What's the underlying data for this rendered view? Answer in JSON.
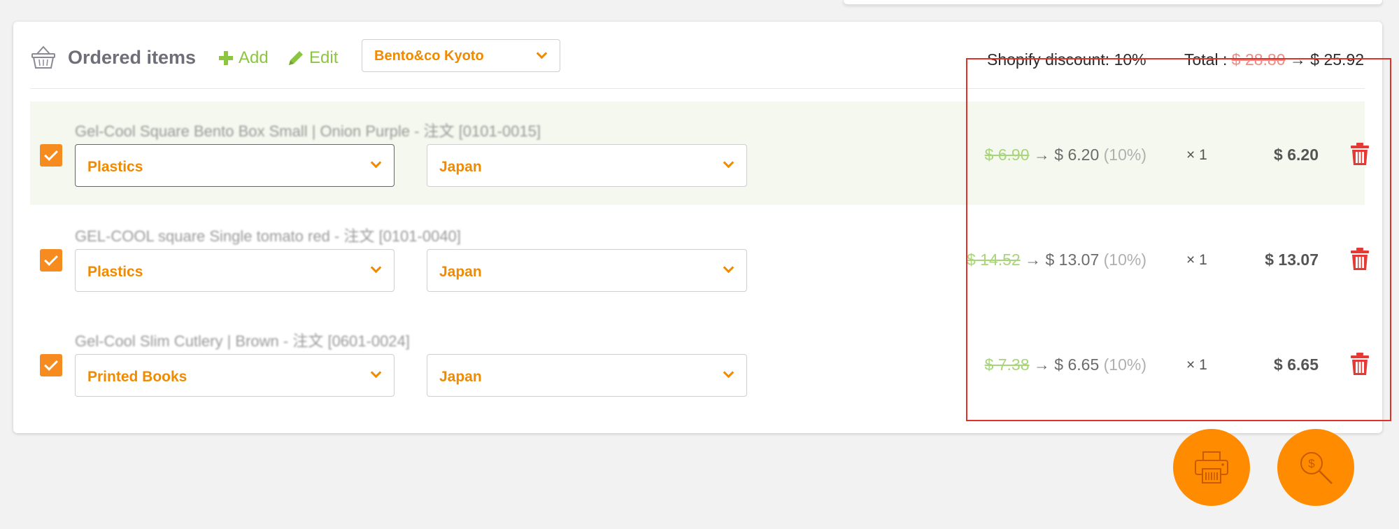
{
  "header": {
    "title": "Ordered items",
    "add_label": "Add",
    "edit_label": "Edit",
    "shop_selected": "Bento&co Kyoto"
  },
  "summary": {
    "discount_label": "Shopify discount:",
    "discount_value": "10%",
    "total_label": "Total :",
    "total_old": "$ 28.80",
    "arrow": "→",
    "total_new": "$ 25.92"
  },
  "items": [
    {
      "checked": true,
      "name": "Gel-Cool Square Bento Box Small | Onion Purple - 注文 [0101-0015]",
      "category": "Plastics",
      "country": "Japan",
      "price_old": "$ 6.90",
      "arrow": "→",
      "price_new": "$ 6.20",
      "discount_pct": "(10%)",
      "qty": "× 1",
      "line_total": "$ 6.20"
    },
    {
      "checked": true,
      "name": "GEL-COOL square Single tomato red - 注文 [0101-0040]",
      "category": "Plastics",
      "country": "Japan",
      "price_old": "$ 14.52",
      "arrow": "→",
      "price_new": "$ 13.07",
      "discount_pct": "(10%)",
      "qty": "× 1",
      "line_total": "$ 13.07"
    },
    {
      "checked": true,
      "name": "Gel-Cool Slim Cutlery | Brown - 注文 [0601-0024]",
      "category": "Printed Books",
      "country": "Japan",
      "price_old": "$ 7.38",
      "arrow": "→",
      "price_new": "$ 6.65",
      "discount_pct": "(10%)",
      "qty": "× 1",
      "line_total": "$ 6.65"
    }
  ],
  "icons": {
    "basket": "basket-icon",
    "add": "plus-icon",
    "edit": "pencil-icon",
    "trash": "trash-icon",
    "print": "printer-icon",
    "price_search": "dollar-search-icon"
  },
  "colors": {
    "accent": "#f08a00",
    "green": "#8cc63f",
    "old_price_green": "#a8d57a",
    "old_total_red": "#ec8c86",
    "trash_red": "#e53935",
    "highlight_row": "#f4f8ee"
  }
}
